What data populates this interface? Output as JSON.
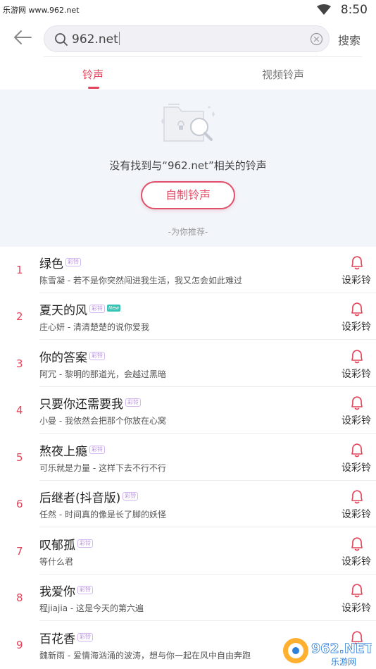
{
  "status_bar": {
    "site": "乐游网 www.962.net",
    "time": "8:50"
  },
  "search": {
    "value": "962.net",
    "button_label": "搜索"
  },
  "tabs": [
    {
      "label": "铃声",
      "active": true
    },
    {
      "label": "视频铃声",
      "active": false
    }
  ],
  "empty_state": {
    "message": "没有找到与“962.net”相关的铃声",
    "action_label": "自制铃声",
    "recommend_label": "-为你推荐-"
  },
  "songs": [
    {
      "rank": "1",
      "title": "绿色",
      "badge": "彩铃",
      "subtitle": "陈雪凝 - 若不是你突然闯进我生活，我又怎会如此难过",
      "action": "设彩铃"
    },
    {
      "rank": "2",
      "title": "夏天的风",
      "badge": "彩铃",
      "new_badge": "New",
      "subtitle": "庄心妍 - 清清楚楚的说你爱我",
      "action": "设彩铃"
    },
    {
      "rank": "3",
      "title": "你的答案",
      "badge": "彩铃",
      "subtitle": "阿冗 - 黎明的那道光，会越过黑暗",
      "action": "设彩铃"
    },
    {
      "rank": "4",
      "title": "只要你还需要我",
      "badge": "彩铃",
      "subtitle": "小曼 - 我依然会把那个你放在心窝",
      "action": "设彩铃"
    },
    {
      "rank": "5",
      "title": "熬夜上瘾",
      "badge": "彩铃",
      "subtitle": "可乐就是力量 - 这样下去不行不行",
      "action": "设彩铃"
    },
    {
      "rank": "6",
      "title": "后继者(抖音版)",
      "badge": "彩铃",
      "subtitle": "任然 - 时间真的像是长了脚的妖怪",
      "action": "设彩铃"
    },
    {
      "rank": "7",
      "title": "叹郁孤",
      "badge": "彩铃",
      "subtitle": "等什么君",
      "action": "设彩铃"
    },
    {
      "rank": "8",
      "title": "我爱你",
      "badge": "彩铃",
      "subtitle": "程jiajia - 这是今天的第六遍",
      "action": "设彩铃"
    },
    {
      "rank": "9",
      "title": "百花香",
      "badge": "彩铃",
      "subtitle": "魏新雨 - 爱情海汹涌的波涛，想与你一起在风中自由奔跑",
      "action": "设彩铃"
    }
  ],
  "watermark": {
    "brand": "962.NET",
    "sub": "乐游网"
  },
  "colors": {
    "accent": "#e2445a",
    "badge": "#b98ee0",
    "new_badge": "#36c4b4",
    "empty_bg": "#f2f5fa"
  }
}
